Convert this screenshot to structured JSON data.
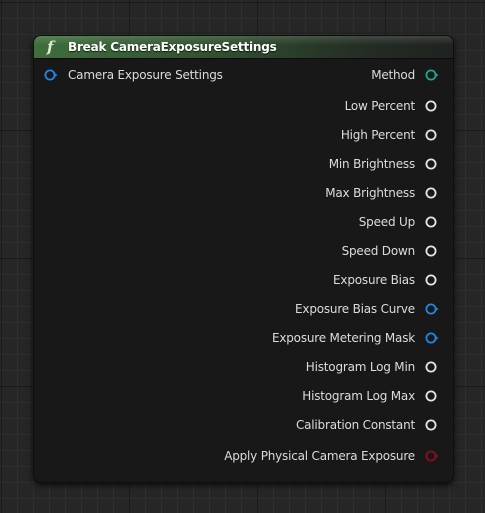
{
  "node": {
    "title": "Break CameraExposureSettings",
    "function_glyph": "f",
    "header_color": "#3f6e3c"
  },
  "input_pin": {
    "label": "Camera Exposure Settings",
    "color": "#1e88e5",
    "icon": "struct-pin-icon"
  },
  "output_pins": [
    {
      "label": "Method",
      "color": "#1aa68f",
      "type": "enum"
    },
    {
      "label": "Low Percent",
      "color": "#e6e6e6",
      "type": "float"
    },
    {
      "label": "High Percent",
      "color": "#e6e6e6",
      "type": "float"
    },
    {
      "label": "Min Brightness",
      "color": "#e6e6e6",
      "type": "float"
    },
    {
      "label": "Max Brightness",
      "color": "#e6e6e6",
      "type": "float"
    },
    {
      "label": "Speed Up",
      "color": "#e6e6e6",
      "type": "float"
    },
    {
      "label": "Speed Down",
      "color": "#e6e6e6",
      "type": "float"
    },
    {
      "label": "Exposure Bias",
      "color": "#e6e6e6",
      "type": "float"
    },
    {
      "label": "Exposure Bias Curve",
      "color": "#1e88e5",
      "type": "object"
    },
    {
      "label": "Exposure Metering Mask",
      "color": "#1e88e5",
      "type": "object"
    },
    {
      "label": "Histogram Log Min",
      "color": "#e6e6e6",
      "type": "float"
    },
    {
      "label": "Histogram Log Max",
      "color": "#e6e6e6",
      "type": "float"
    },
    {
      "label": "Calibration Constant",
      "color": "#e6e6e6",
      "type": "float"
    },
    {
      "label": "Apply Physical Camera Exposure",
      "color": "#8e0f18",
      "type": "bool"
    }
  ]
}
